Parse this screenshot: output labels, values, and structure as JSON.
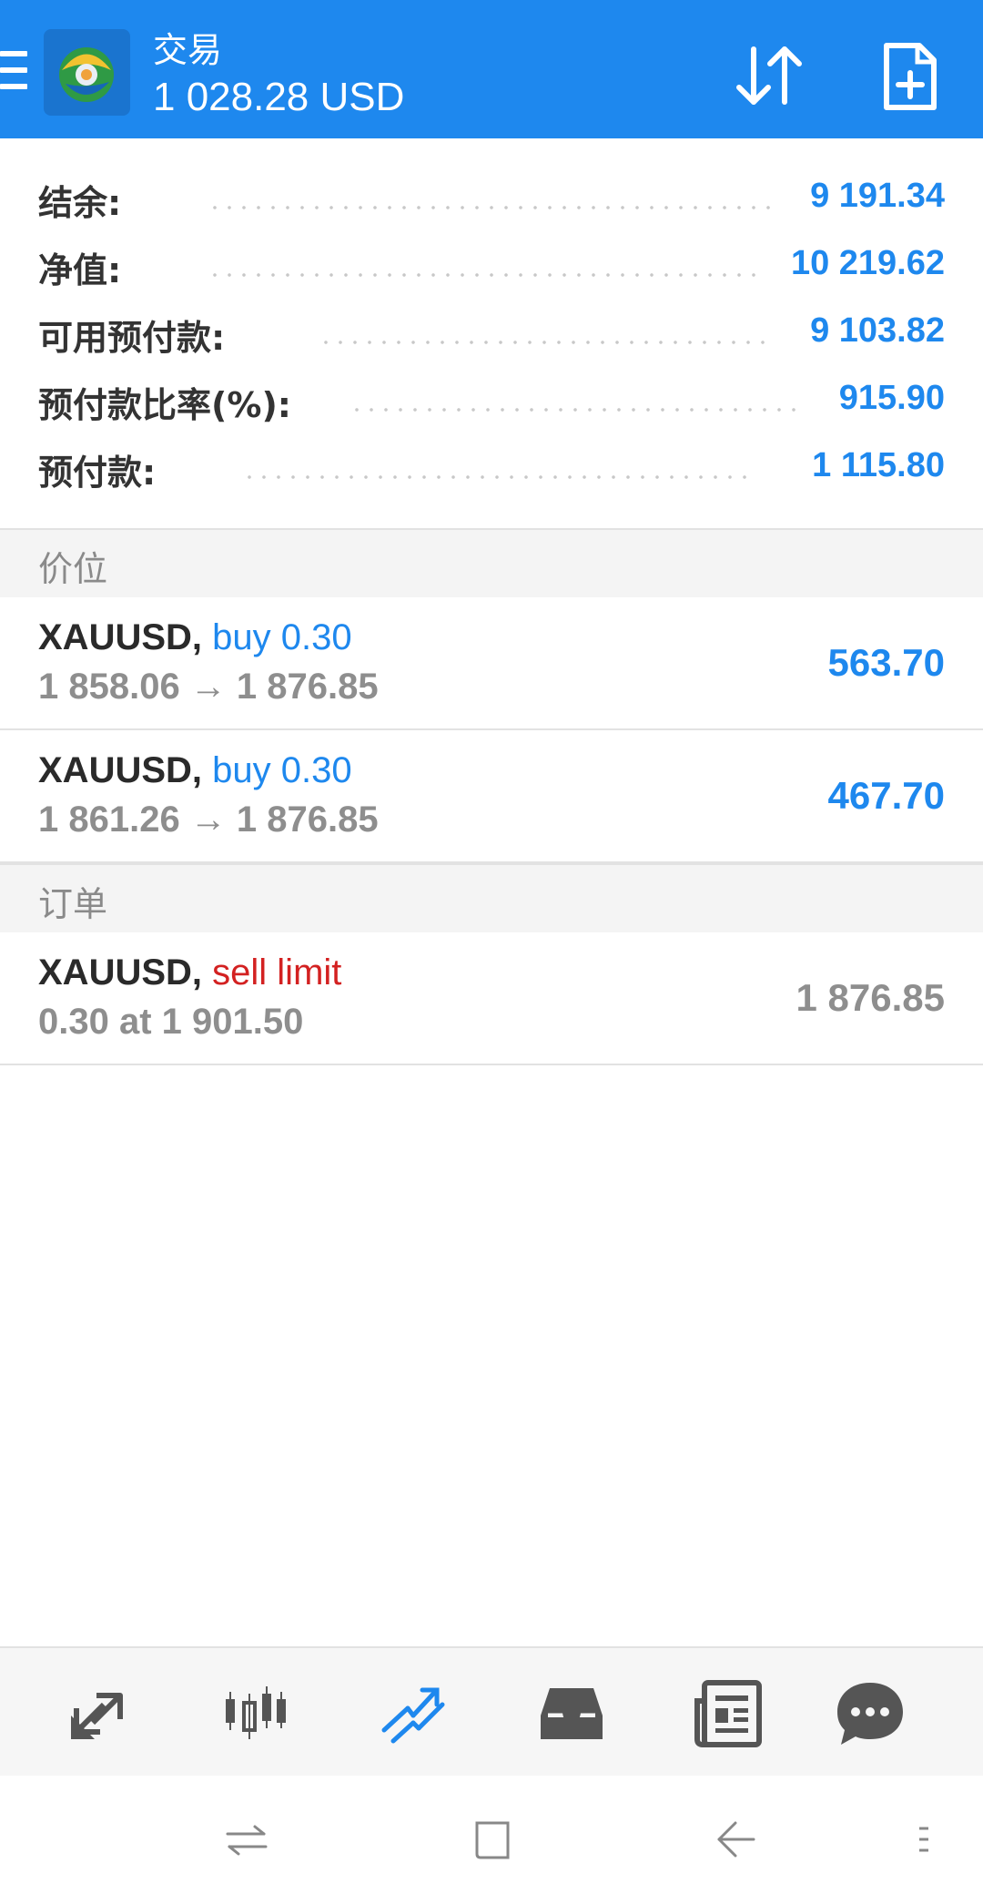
{
  "header": {
    "title": "交易",
    "balance": "1 028.28 USD"
  },
  "summary": [
    {
      "label": "结余:",
      "value": "9 191.34"
    },
    {
      "label": "净值:",
      "value": "10 219.62"
    },
    {
      "label": "可用预付款:",
      "value": "9 103.82"
    },
    {
      "label": "预付款比率(%):",
      "value": "915.90"
    },
    {
      "label": "预付款:",
      "value": "1 115.80"
    }
  ],
  "positions": {
    "header": "价位",
    "items": [
      {
        "symbol": "XAUUSD,",
        "direction": "buy 0.30",
        "prices": "1 858.06 → 1 876.85",
        "profit": "563.70"
      },
      {
        "symbol": "XAUUSD,",
        "direction": "buy 0.30",
        "prices": "1 861.26 → 1 876.85",
        "profit": "467.70"
      }
    ]
  },
  "orders": {
    "header": "订单",
    "items": [
      {
        "symbol": "XAUUSD,",
        "type": "sell limit",
        "detail": "0.30 at 1 901.50",
        "price": "1 876.85"
      }
    ]
  },
  "bottom_nav": [
    {
      "name": "quotes-icon",
      "active": false
    },
    {
      "name": "charts-icon",
      "active": false
    },
    {
      "name": "trade-icon",
      "active": true
    },
    {
      "name": "history-icon",
      "active": false
    },
    {
      "name": "news-icon",
      "active": false
    },
    {
      "name": "chat-icon",
      "active": false
    }
  ],
  "colors": {
    "brand_blue": "#1e88ee",
    "sell_red": "#d32121",
    "muted_gray": "#8e8e8e"
  }
}
